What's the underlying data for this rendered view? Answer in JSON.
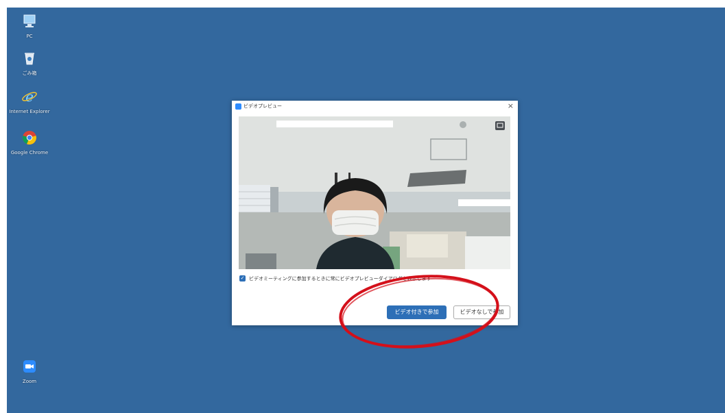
{
  "desktop": {
    "icons": [
      {
        "label": "PC",
        "icon": "computer-icon"
      },
      {
        "label": "ごみ箱",
        "icon": "recycle-bin-icon"
      },
      {
        "label": "Internet Explorer",
        "icon": "internet-explorer-icon"
      },
      {
        "label": "Google Chrome",
        "icon": "chrome-icon"
      },
      {
        "label": "Zoom",
        "icon": "zoom-icon"
      }
    ]
  },
  "dialog": {
    "title": "ビデオプレビュー",
    "close_glyph": "×",
    "preview_checkbox_label": "ビデオミーティングに参加するときに常にビデオプレビューダイアログを表示します",
    "join_with_video_label": "ビデオ付きで参加",
    "join_without_video_label": "ビデオなしで参加"
  },
  "colors": {
    "desktop_bg": "#33689e",
    "primary_button": "#2d6fb7",
    "annotation": "#d4101a"
  }
}
